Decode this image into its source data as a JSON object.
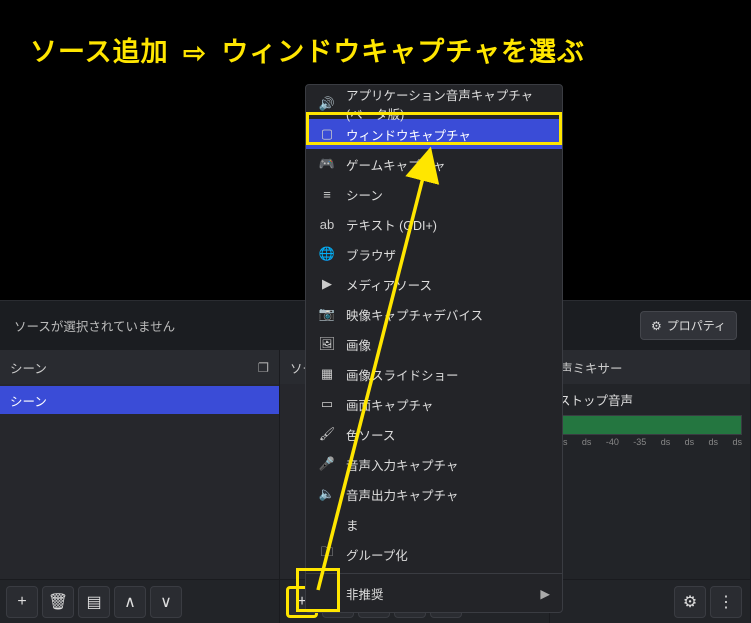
{
  "instruction": {
    "prefix": "ソース追加",
    "arrow": "⇨",
    "suffix": "ウィンドウキャプチャを選ぶ"
  },
  "statusbar": {
    "no_source_selected": "ソースが選択されていません",
    "properties_btn": "プロパティ"
  },
  "scenes_dock": {
    "title": "シーン",
    "items": [
      "シーン"
    ]
  },
  "sources_dock": {
    "title": "ソース"
  },
  "mixer_dock": {
    "title_suffix": "声ミキサー",
    "track1": "ストップ音声",
    "db_marks": [
      "ds",
      "ds",
      "-40",
      "-35",
      "ds",
      "ds",
      "ds",
      "ds"
    ]
  },
  "context_menu": {
    "items": [
      {
        "icon": "🔊",
        "label": "アプリケーション音声キャプチャ (ベータ版)"
      },
      {
        "icon": "▢",
        "label": "ウィンドウキャプチャ",
        "selected": true
      },
      {
        "icon": "🎮",
        "label": "ゲームキャプチャ"
      },
      {
        "icon": "≡",
        "label": "シーン"
      },
      {
        "icon": "ab",
        "label": "テキスト (GDI+)"
      },
      {
        "icon": "🌐",
        "label": "ブラウザ"
      },
      {
        "icon": "▶",
        "label": "メディアソース"
      },
      {
        "icon": "📷",
        "label": "映像キャプチャデバイス"
      },
      {
        "icon": "🖼",
        "label": "画像"
      },
      {
        "icon": "▦",
        "label": "画像スライドショー"
      },
      {
        "icon": "▭",
        "label": "画面キャプチャ"
      },
      {
        "icon": "🖌",
        "label": "色ソース"
      },
      {
        "icon": "🎤",
        "label": "音声入力キャプチャ"
      },
      {
        "icon": "🔈",
        "label": "音声出力キャプチャ"
      }
    ],
    "partial_label": "ま",
    "group_item": {
      "icon": "🗀",
      "label": "グループ化"
    },
    "deprecated_label": "非推奨"
  },
  "toolbar_icons": {
    "add": "+",
    "remove": "🗑",
    "filters": "▤",
    "up": "∧",
    "down": "∨",
    "gear": "⚙",
    "more": "⋮"
  }
}
